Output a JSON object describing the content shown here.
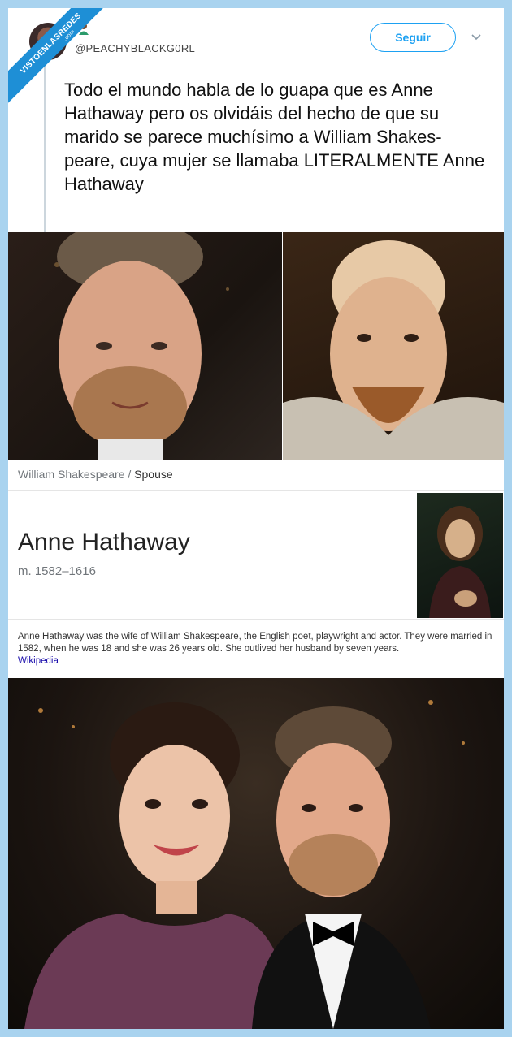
{
  "watermark": {
    "main": "VISTOENLASREDES",
    "sub": ".com"
  },
  "header": {
    "handle": "@PEACHYBLACKG0RL",
    "follow_label": "Seguir"
  },
  "tweet": {
    "text": "Todo el mundo habla de lo guapa que es Anne Hathaway pero os olvidáis del hecho de que su marido se parece muchísimo a William Shakes-\npeare, cuya mujer se llamaba LITERALMENTE Anne Hathaway"
  },
  "knowledge_panel": {
    "breadcrumb_parent": "William Shakespeare",
    "breadcrumb_sep": "/",
    "breadcrumb_current": "Spouse",
    "name": "Anne Hathaway",
    "dates": "m. 1582–1616",
    "description": "Anne Hathaway was the wife of William Shakespeare, the English poet, playwright and actor. They were married in 1582, when he was 18 and she was 26 years old. She outlived her husband by seven years.",
    "source_link": "Wikipedia"
  },
  "colors": {
    "accent": "#1da1f2",
    "link": "#1a0dab",
    "banner": "#1e8fd6",
    "outer_bg": "#a9d3ef"
  },
  "icons": [
    "chevron-down-icon",
    "avatar",
    "emoji-icon"
  ]
}
